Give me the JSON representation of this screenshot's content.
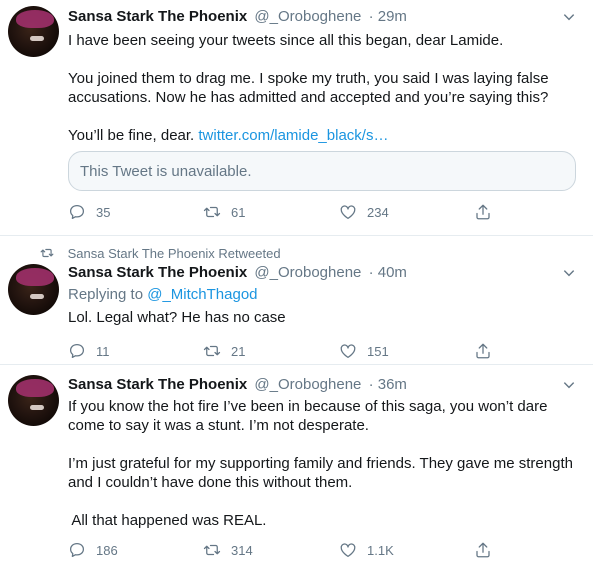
{
  "tweets": [
    {
      "name": "Sansa Stark The Phoenix",
      "handle": "@_Oroboghene",
      "time": "· 29m",
      "paragraphs": [
        "I have been seeing your tweets since all this began, dear Lamide.",
        "You joined them to drag me. I spoke my truth, you said I was laying false accusations. Now he has admitted and accepted and you’re saying this?"
      ],
      "last_line_text": "You’ll be fine, dear. ",
      "link_text": "twitter.com/lamide_black/s…",
      "quote_text": "This Tweet is unavailable.",
      "replies": "35",
      "retweets": "61",
      "likes": "234"
    },
    {
      "retweeted_by": "Sansa Stark The Phoenix Retweeted",
      "name": "Sansa Stark The Phoenix",
      "handle": "@_Oroboghene",
      "time": "· 40m",
      "replying_to_label": "Replying to ",
      "replying_to_handle": "@_MitchThagod",
      "text": "Lol. Legal what? He has no case",
      "replies": "11",
      "retweets": "21",
      "likes": "151"
    },
    {
      "name": "Sansa Stark The Phoenix",
      "handle": "@_Oroboghene",
      "time": "· 36m",
      "paragraphs": [
        "If you know the hot fire I’ve been in because of this saga, you won’t dare come to say it was a stunt. I’m not desperate.",
        "I’m just grateful for my supporting family and friends. They gave me strength and I couldn’t have done this without them.",
        " All that happened was REAL."
      ],
      "replies": "186",
      "retweets": "314",
      "likes": "1.1K"
    }
  ],
  "colors": {
    "accent": "#1b95e0",
    "muted": "#657786",
    "text": "#14171a",
    "border": "#e6ecf0"
  },
  "icons": [
    "reply-icon",
    "retweet-icon",
    "like-icon",
    "share-icon",
    "chevron-down-icon"
  ]
}
